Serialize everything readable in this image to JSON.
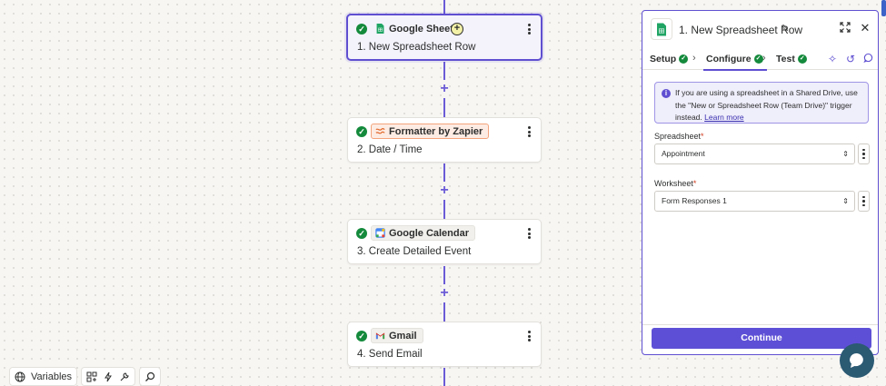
{
  "steps": [
    {
      "app": "Google Sheets",
      "title": "1. New Spreadsheet Row",
      "icon": "google-sheets-icon"
    },
    {
      "app": "Formatter by Zapier",
      "title": "2. Date / Time",
      "icon": "formatter-icon"
    },
    {
      "app": "Google Calendar",
      "title": "3. Create Detailed Event",
      "icon": "google-calendar-icon"
    },
    {
      "app": "Gmail",
      "title": "4. Send Email",
      "icon": "gmail-icon"
    }
  ],
  "toolbar": {
    "variables_label": "Variables"
  },
  "panel": {
    "title": "1. New Spreadsheet Row",
    "tabs": {
      "setup": "Setup",
      "configure": "Configure",
      "test": "Test"
    },
    "info": {
      "text": "If you are using a spreadsheet in a Shared Drive, use the \"New or Spreadsheet Row (Team Drive)\" trigger instead.",
      "link": "Learn more"
    },
    "spreadsheet": {
      "label": "Spreadsheet",
      "required": "*",
      "value": "Appointment"
    },
    "worksheet": {
      "label": "Worksheet",
      "required": "*",
      "value": "Form Responses 1"
    },
    "continue_label": "Continue"
  },
  "colors": {
    "accent": "#5f4fd1",
    "success": "#148a3c",
    "chat": "#2b5a73"
  }
}
